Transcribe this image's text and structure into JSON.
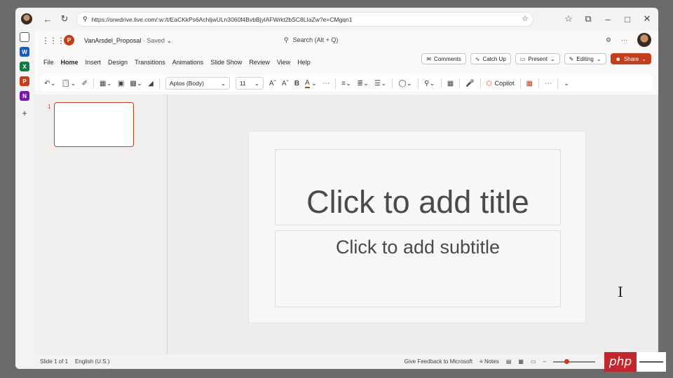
{
  "browser": {
    "url": "https://onedrive.live.com/:w:/t/EaCKkPs6AchIjwULn3060f4BvbBjylAFWrkt2bSC8LIaZw?e=CMgqn1"
  },
  "app": {
    "doc_name": "VanArsdel_Proposal",
    "saved_status": "· Saved",
    "search_placeholder": "Search (Alt + Q)",
    "tabs": [
      "File",
      "Home",
      "Insert",
      "Design",
      "Transitions",
      "Animations",
      "Slide Show",
      "Review",
      "View",
      "Help"
    ],
    "active_tab": "Home",
    "actions": {
      "comments": "Comments",
      "catch_up": "Catch Up",
      "present": "Present",
      "editing": "Editing",
      "share": "Share"
    },
    "ribbon": {
      "font_name": "Aptos (Body)",
      "font_size": "11",
      "bold": "B",
      "copilot": "Copilot"
    }
  },
  "thumbnails": [
    {
      "number": "1"
    }
  ],
  "slide": {
    "title_placeholder": "Click to add title",
    "subtitle_placeholder": "Click to add subtitle"
  },
  "status_bar": {
    "slide_info": "Slide 1 of 1",
    "language": "English (U.S.)",
    "feedback": "Give Feedback to Microsoft",
    "notes": "Notes"
  },
  "watermark": {
    "text": "php"
  },
  "colors": {
    "accent": "#c43e1c"
  }
}
